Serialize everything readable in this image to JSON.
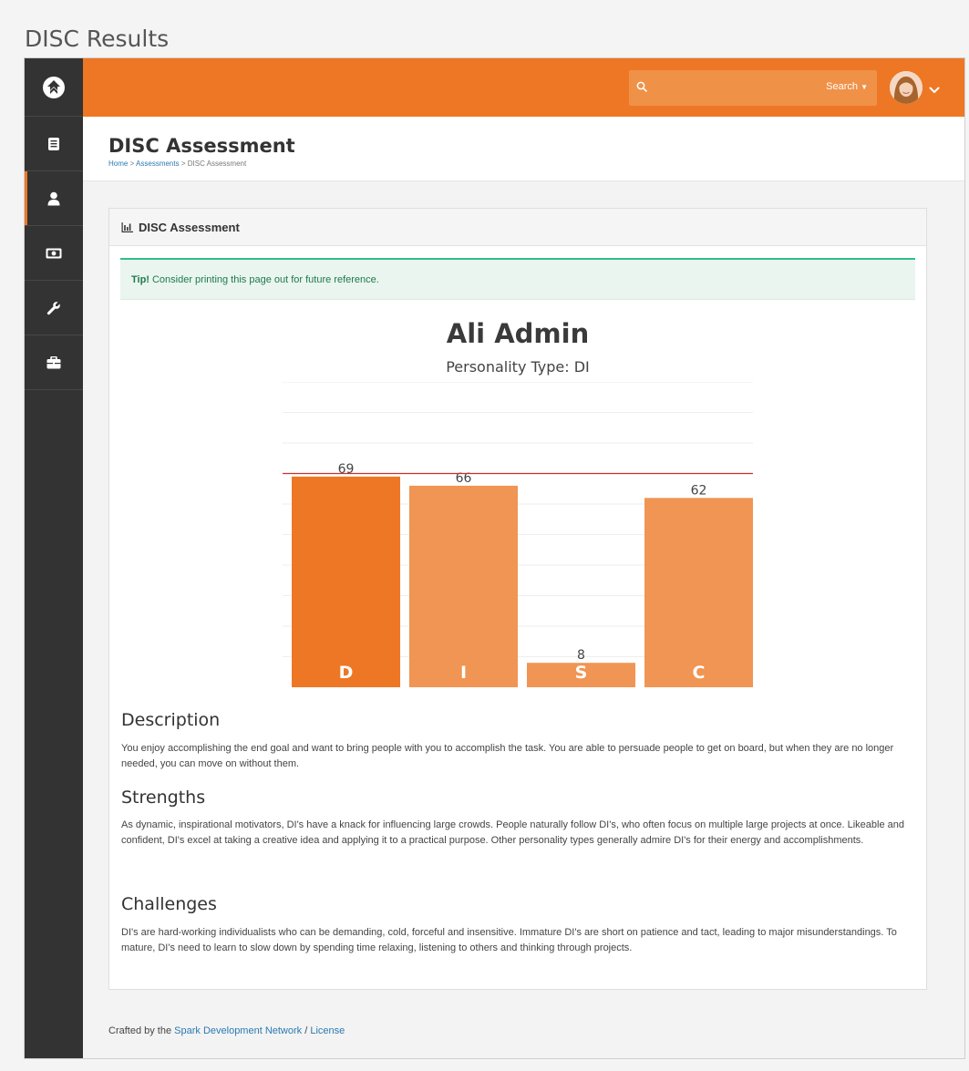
{
  "caption": "DISC Results",
  "search": {
    "placeholder": "",
    "button_label": "Search"
  },
  "sidebar": {
    "items": [
      {
        "icon": "book-icon"
      },
      {
        "icon": "person-icon"
      },
      {
        "icon": "money-icon"
      },
      {
        "icon": "wrench-icon"
      },
      {
        "icon": "briefcase-icon"
      }
    ]
  },
  "header": {
    "title": "DISC Assessment",
    "breadcrumb": [
      "Home",
      "Assessments",
      "DISC Assessment"
    ],
    "separator": ">"
  },
  "panel": {
    "title": "DISC Assessment",
    "tip_label": "Tip!",
    "tip_text": "Consider printing this page out for future reference.",
    "person_name": "Ali Admin",
    "personality_type": "Personality Type: DI"
  },
  "chart_data": {
    "type": "bar",
    "categories": [
      "D",
      "I",
      "S",
      "C"
    ],
    "values": [
      69,
      66,
      8,
      62
    ],
    "ylim": [
      0,
      100
    ],
    "reference_line": 70,
    "grid": true,
    "highlight_index": 0,
    "colors": {
      "primary": "#ee7725",
      "secondary": "#f09553",
      "reference": "#c9302c",
      "grid": "#eeeeee"
    }
  },
  "sections": [
    {
      "title": "Description",
      "text": "You enjoy accomplishing the end goal and want to bring people with you to accomplish the task. You are able to persuade people to get on board, but when they are no longer needed, you can move on without them."
    },
    {
      "title": "Strengths",
      "text": "As dynamic, inspirational motivators, DI's have a knack for influencing large crowds. People naturally follow DI's, who often focus on multiple large projects at once. Likeable and confident, DI's excel at taking a creative idea and applying it to a practical purpose. Other personality types generally admire DI's for their energy and accomplishments."
    },
    {
      "title": "Challenges",
      "text": "DI's are hard-working individualists who can be demanding, cold, forceful and insensitive. Immature DI's are short on patience and tact, leading to major misunderstandings. To mature, DI's need to learn to slow down by spending time relaxing, listening to others and thinking through projects."
    }
  ],
  "footer": {
    "prefix": "Crafted by the",
    "link_text": "Spark Development Network",
    "divider": "/",
    "license_text": "License"
  },
  "colors": {
    "accent": "#ee7725",
    "sidebar": "#333333",
    "success": "#2fbf87",
    "link": "#2a7ab0"
  }
}
